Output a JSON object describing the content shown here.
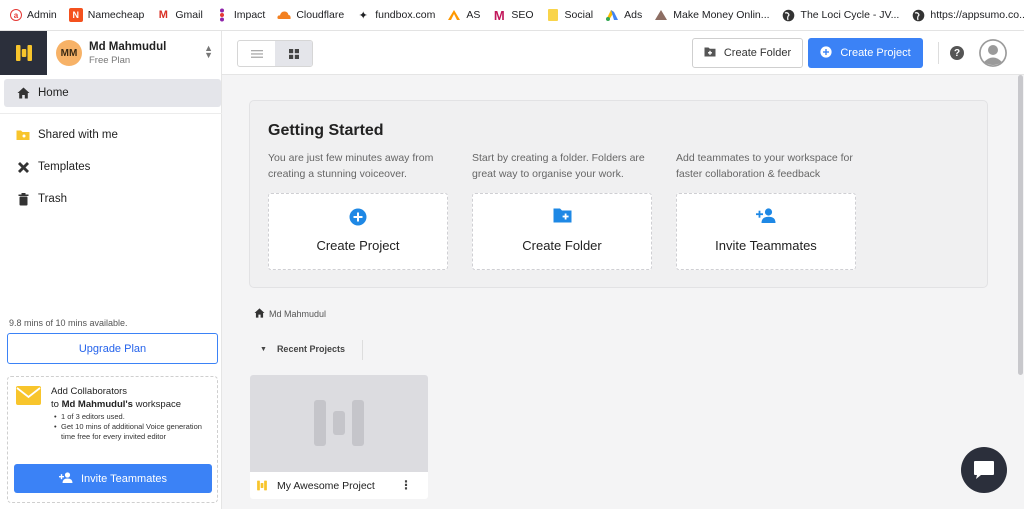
{
  "bookmarks": [
    {
      "label": "Admin",
      "icon": "admin-icon",
      "color": "#e53935"
    },
    {
      "label": "Namecheap",
      "icon": "namecheap-icon",
      "color": "#f4511e"
    },
    {
      "label": "Gmail",
      "icon": "gmail-icon",
      "color": "#d93025"
    },
    {
      "label": "Impact",
      "icon": "impact-icon",
      "color": "#8e24aa"
    },
    {
      "label": "Cloudflare",
      "icon": "cloudflare-icon",
      "color": "#f38020"
    },
    {
      "label": "fundbox.com",
      "icon": "fundbox-icon",
      "color": "#333333"
    },
    {
      "label": "AS",
      "icon": "as-icon",
      "color": "#ff9800"
    },
    {
      "label": "SEO",
      "icon": "seo-icon",
      "color": "#c2185b"
    },
    {
      "label": "Social",
      "icon": "folder-icon",
      "color": "#f9d44a"
    },
    {
      "label": "Ads",
      "icon": "google-ads-icon",
      "color": "#4285f4"
    },
    {
      "label": "Make Money Onlin...",
      "icon": "make-money-icon",
      "color": "#8d6e63"
    },
    {
      "label": "The Loci Cycle - JV...",
      "icon": "globe-icon",
      "color": "#333333"
    },
    {
      "label": "https://appsumo.co...",
      "icon": "globe-icon",
      "color": "#333333"
    }
  ],
  "account": {
    "initials": "MM",
    "name": "Md Mahmudul",
    "plan": "Free Plan"
  },
  "nav": {
    "home": "Home",
    "shared": "Shared with me",
    "templates": "Templates",
    "trash": "Trash"
  },
  "usage": {
    "text": "9.8 mins of 10 mins available.",
    "upgrade_label": "Upgrade Plan"
  },
  "collaborators": {
    "title_line1": "Add Collaborators",
    "title_prefix": "to ",
    "title_name": "Md Mahmudul's",
    "title_suffix": " workspace",
    "bullets": [
      "1 of 3 editors used.",
      "Get 10 mins of additional Voice generation time free for every invited editor"
    ],
    "invite_label": "Invite Teammates"
  },
  "toolbar": {
    "create_folder_label": "Create Folder",
    "create_project_label": "Create Project",
    "help_label": "?"
  },
  "getting_started": {
    "title": "Getting Started",
    "columns": [
      {
        "description": "You are just few minutes away from creating a stunning voiceover.",
        "card_label": "Create Project"
      },
      {
        "description": "Start by creating a folder. Folders are great way to organise your work.",
        "card_label": "Create Folder"
      },
      {
        "description": "Add teammates to your workspace for faster collaboration & feedback",
        "card_label": "Invite Teammates"
      }
    ]
  },
  "breadcrumb": {
    "label": "Md Mahmudul"
  },
  "recent": {
    "label": "Recent Projects"
  },
  "projects": [
    {
      "name": "My Awesome Project"
    }
  ],
  "colors": {
    "accent": "#3b82f6",
    "logo_bg": "#2b2f3b",
    "brand_yellow": "#f8c52c"
  }
}
